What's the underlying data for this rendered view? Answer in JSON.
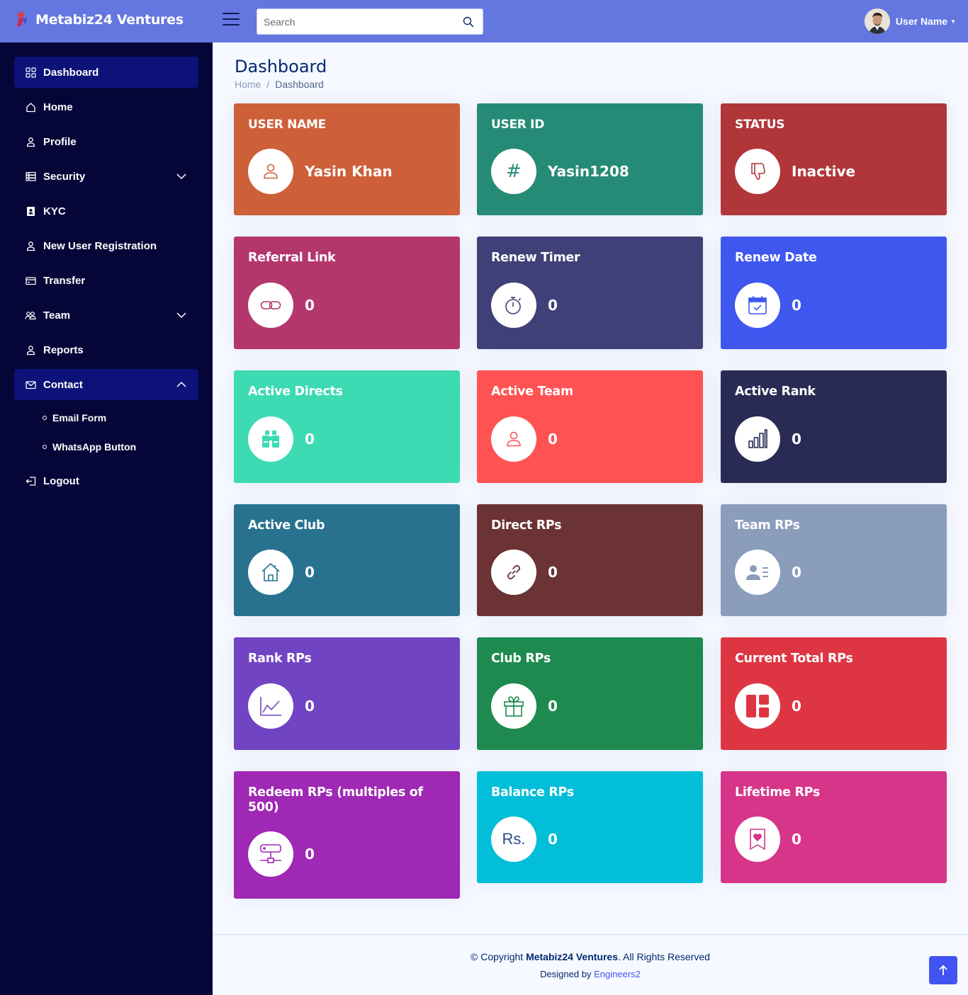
{
  "header": {
    "brand": "Metabiz24 Ventures",
    "search_placeholder": "Search",
    "user_name": "User Name"
  },
  "sidebar": {
    "items": [
      {
        "label": "Dashboard",
        "icon": "grid-icon",
        "active": true
      },
      {
        "label": "Home",
        "icon": "house-icon"
      },
      {
        "label": "Profile",
        "icon": "person-icon"
      },
      {
        "label": "Security",
        "icon": "server-icon",
        "chevron": "down"
      },
      {
        "label": "KYC",
        "icon": "id-badge-icon"
      },
      {
        "label": "New User Registration",
        "icon": "person-icon"
      },
      {
        "label": "Transfer",
        "icon": "credit-card-icon"
      },
      {
        "label": "Team",
        "icon": "people-icon",
        "chevron": "down"
      },
      {
        "label": "Reports",
        "icon": "person-icon"
      },
      {
        "label": "Contact",
        "icon": "envelope-icon",
        "chevron": "up",
        "expanded": true
      },
      {
        "label": "Logout",
        "icon": "logout-icon"
      }
    ],
    "contact_subitems": [
      "Email Form",
      "WhatsApp Button"
    ]
  },
  "page": {
    "title": "Dashboard",
    "breadcrumb": [
      "Home",
      "Dashboard"
    ]
  },
  "cards": [
    {
      "title": "USER NAME",
      "value": "Yasin Khan",
      "icon": "person-icon",
      "color": "#cd5f39"
    },
    {
      "title": "USER ID",
      "value": "Yasin1208",
      "icon": "hash-icon",
      "color": "#268b76"
    },
    {
      "title": "STATUS",
      "value": "Inactive",
      "icon": "thumbs-down-icon",
      "color": "#b0363a"
    },
    {
      "title": "Referral Link",
      "value": "0",
      "icon": "link-icon",
      "color": "#b3376d"
    },
    {
      "title": "Renew Timer",
      "value": "0",
      "icon": "stopwatch-icon",
      "color": "#3f4078"
    },
    {
      "title": "Renew Date",
      "value": "0",
      "icon": "calendar-check-icon",
      "color": "#3f57ee"
    },
    {
      "title": "Active Directs",
      "value": "0",
      "icon": "binoculars-icon",
      "color": "#3ddab4"
    },
    {
      "title": "Active Team",
      "value": "0",
      "icon": "person-icon",
      "color": "#ff5252"
    },
    {
      "title": "Active Rank",
      "value": "0",
      "icon": "bar-chart-icon",
      "color": "#292b55"
    },
    {
      "title": "Active Club",
      "value": "0",
      "icon": "house-icon",
      "color": "#287290"
    },
    {
      "title": "Direct RPs",
      "value": "0",
      "icon": "link-icon",
      "color": "#6b3333"
    },
    {
      "title": "Team RPs",
      "value": "0",
      "icon": "person-lines-icon",
      "color": "#8a9dbb"
    },
    {
      "title": "Rank RPs",
      "value": "0",
      "icon": "graph-up-icon",
      "color": "#7144c4"
    },
    {
      "title": "Club RPs",
      "value": "0",
      "icon": "gift-icon",
      "color": "#1e8a50"
    },
    {
      "title": "Current Total RPs",
      "value": "0",
      "icon": "layout-icon",
      "color": "#de3543"
    },
    {
      "title": "Redeem RPs (multiples of 500)",
      "value": "0",
      "icon": "hdd-network-icon",
      "color": "#9f28b4"
    },
    {
      "title": "Balance RPs",
      "value": "0",
      "icon": "rupee-icon",
      "icon_text": "Rs.",
      "color": "#02bed8"
    },
    {
      "title": "Lifetime RPs",
      "value": "0",
      "icon": "bookmark-heart-icon",
      "color": "#d73589"
    }
  ],
  "footer": {
    "copyright_prefix": "© Copyright",
    "company": "Metabiz24 Ventures",
    "rights": ". All Rights Reserved",
    "designed_by": "Designed by",
    "designer": "Engineers2"
  }
}
